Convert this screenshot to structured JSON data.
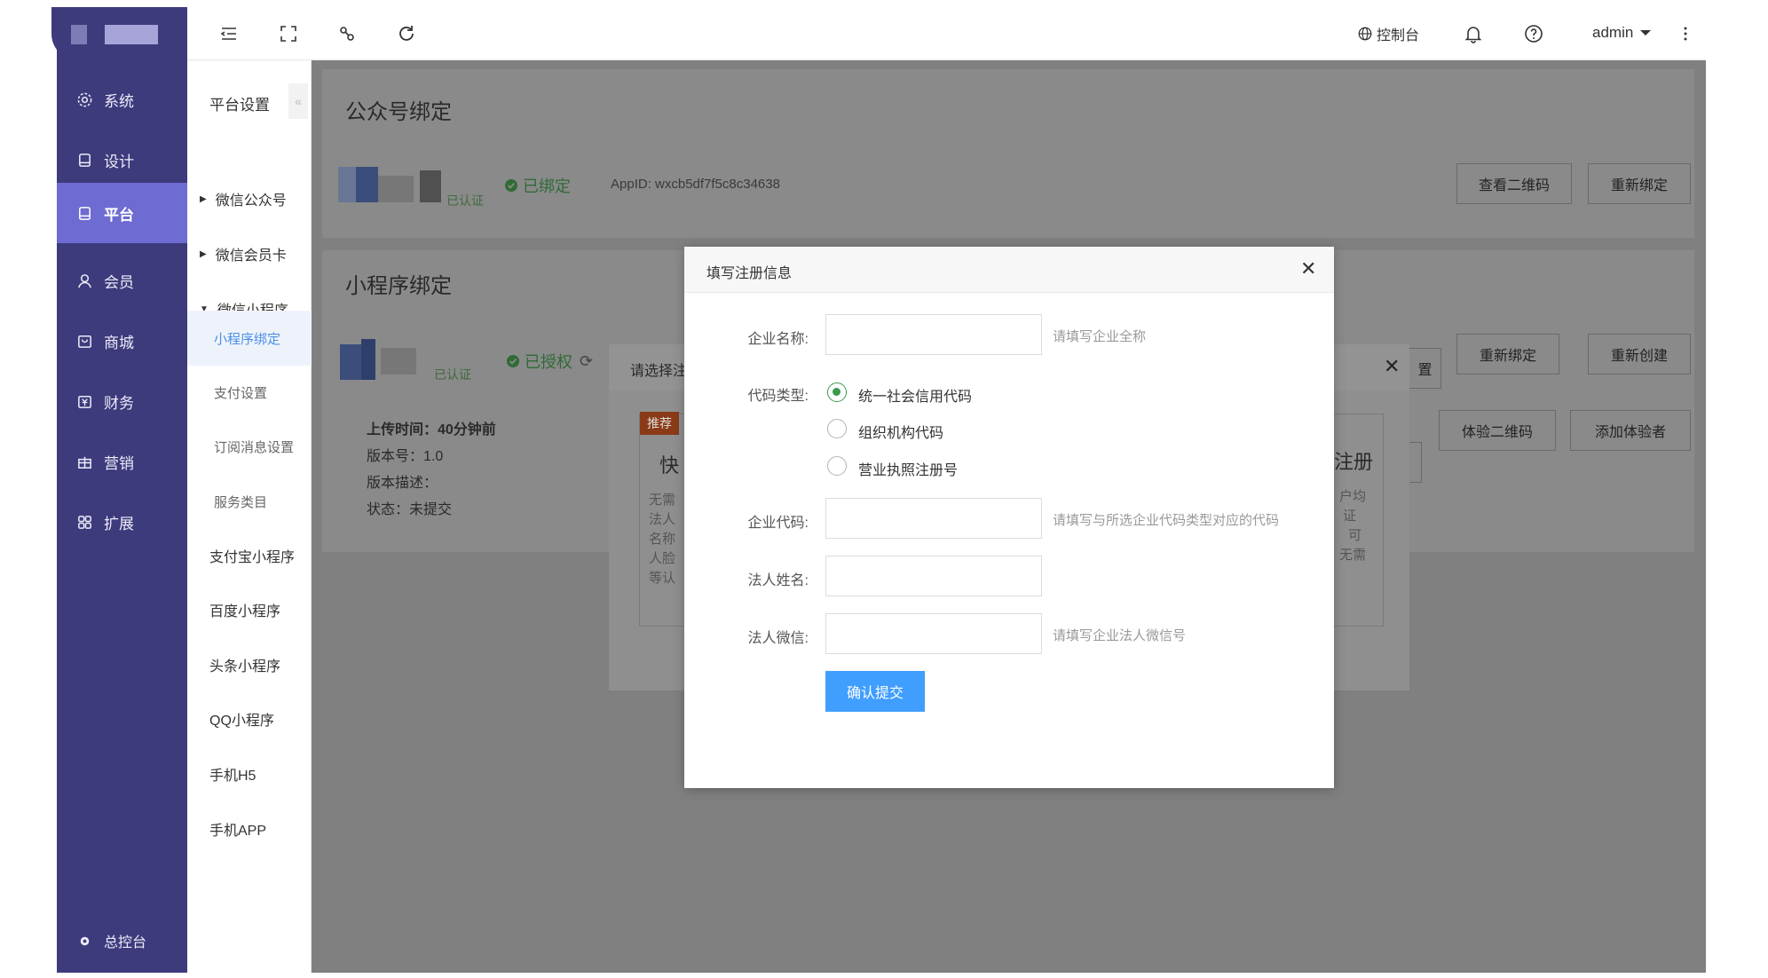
{
  "header": {
    "console_label": "控制台",
    "user_name": "admin"
  },
  "sidebar": {
    "items": [
      {
        "label": "系统",
        "icon": "gear-icon"
      },
      {
        "label": "设计",
        "icon": "design-icon"
      },
      {
        "label": "平台",
        "icon": "platform-icon"
      },
      {
        "label": "会员",
        "icon": "user-icon"
      },
      {
        "label": "商城",
        "icon": "shop-icon"
      },
      {
        "label": "财务",
        "icon": "finance-icon"
      },
      {
        "label": "营销",
        "icon": "gift-icon"
      },
      {
        "label": "扩展",
        "icon": "grid-icon"
      }
    ],
    "footer_label": "总控台",
    "active_index": 2
  },
  "submenu": {
    "title": "平台设置",
    "items": [
      {
        "label": "微信公众号",
        "arrow": "right"
      },
      {
        "label": "微信会员卡",
        "arrow": "right"
      },
      {
        "label": "微信小程序",
        "arrow": "down"
      },
      {
        "label": "小程序绑定",
        "arrow": ""
      },
      {
        "label": "支付设置",
        "arrow": ""
      },
      {
        "label": "订阅消息设置",
        "arrow": ""
      },
      {
        "label": "服务类目",
        "arrow": ""
      },
      {
        "label": "支付宝小程序",
        "arrow": ""
      },
      {
        "label": "百度小程序",
        "arrow": ""
      },
      {
        "label": "头条小程序",
        "arrow": ""
      },
      {
        "label": "QQ小程序",
        "arrow": ""
      },
      {
        "label": "手机H5",
        "arrow": ""
      },
      {
        "label": "手机APP",
        "arrow": ""
      }
    ]
  },
  "main": {
    "official_account": {
      "title": "公众号绑定",
      "verified_tag": "已认证",
      "status": "已绑定",
      "appid": "AppID:  wxcb5df7f5c8c34638",
      "buttons": [
        "查看二维码",
        "重新绑定"
      ]
    },
    "mini_program": {
      "title": "小程序绑定",
      "verified_tag": "已认证",
      "status": "已授权",
      "buttons": [
        "重新绑定",
        "重新创建"
      ],
      "buttons_row2": [
        "体验二维码",
        "添加体验者"
      ],
      "upload_time": "上传时间：40分钟前",
      "version": "版本号：1.0",
      "description": "版本描述：",
      "state": "状态：未提交"
    },
    "back_dialog": {
      "title_partial": "请选择注",
      "badge": "推荐",
      "card_left_title": "快",
      "card_left_lines": [
        "无需",
        "法人",
        "名称",
        "人脸",
        "等认"
      ],
      "card_right_title": "注册",
      "card_right_lines": [
        "户均",
        "证",
        "可",
        "无需"
      ],
      "partial_button": "置"
    }
  },
  "modal": {
    "title": "填写注册信息",
    "fields": {
      "company_name_label": "企业名称:",
      "company_name_hint": "请填写企业全称",
      "code_type_label": "代码类型:",
      "code_type_options": [
        "统一社会信用代码",
        "组织机构代码",
        "营业执照注册号"
      ],
      "code_type_selected": 0,
      "company_code_label": "企业代码:",
      "company_code_hint": "请填写与所选企业代码类型对应的代码",
      "legal_name_label": "法人姓名:",
      "legal_wechat_label": "法人微信:",
      "legal_wechat_hint": "请填写企业法人微信号"
    },
    "submit_label": "确认提交"
  },
  "colors": {
    "sidebar_bg": "#3d3b7c",
    "sidebar_active": "#6e6bd2",
    "primary_button": "#409eff",
    "success_green": "#3a9a4e",
    "recommend_orange": "#e0531e"
  }
}
